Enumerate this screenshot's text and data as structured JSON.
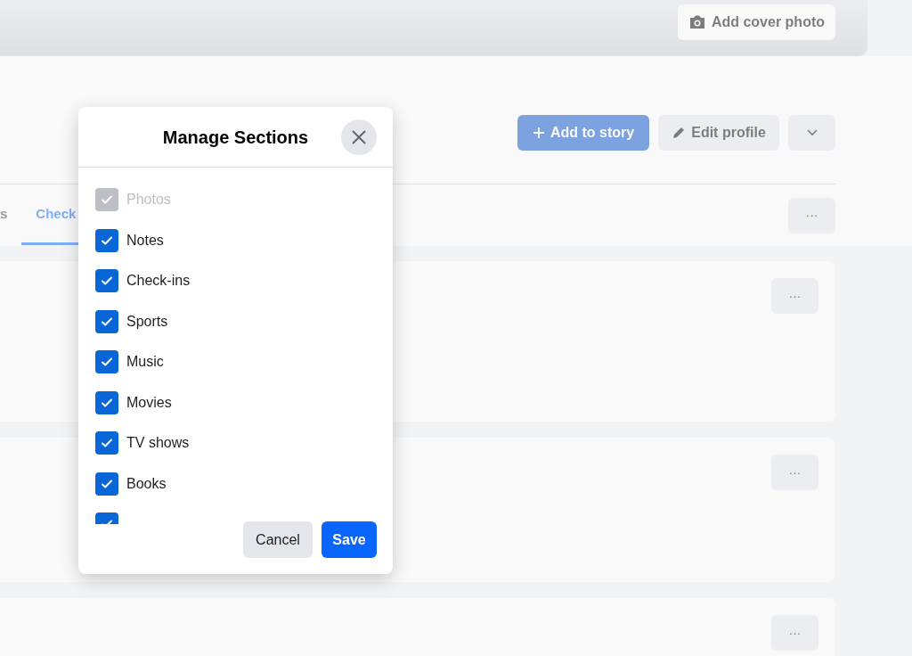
{
  "cover": {
    "add_cover_photo": "Add cover photo"
  },
  "profile_actions": {
    "add_to_story": "Add to story",
    "edit_profile": "Edit profile"
  },
  "tabs": [
    {
      "label": "s",
      "selected": false
    },
    {
      "label": "Check",
      "selected": true
    }
  ],
  "cards": [
    {
      "more": "···"
    },
    {
      "more": "···"
    },
    {
      "more": "···"
    }
  ],
  "tabs_more": "···",
  "dialog": {
    "title": "Manage Sections",
    "items": [
      {
        "label": "Photos",
        "checked": true,
        "disabled": true
      },
      {
        "label": "Notes",
        "checked": true,
        "disabled": false
      },
      {
        "label": "Check-ins",
        "checked": true,
        "disabled": false
      },
      {
        "label": "Sports",
        "checked": true,
        "disabled": false
      },
      {
        "label": "Music",
        "checked": true,
        "disabled": false
      },
      {
        "label": "Movies",
        "checked": true,
        "disabled": false
      },
      {
        "label": "TV shows",
        "checked": true,
        "disabled": false
      },
      {
        "label": "Books",
        "checked": true,
        "disabled": false
      },
      {
        "checked": true,
        "disabled": false
      }
    ],
    "cancel": "Cancel",
    "save": "Save"
  }
}
